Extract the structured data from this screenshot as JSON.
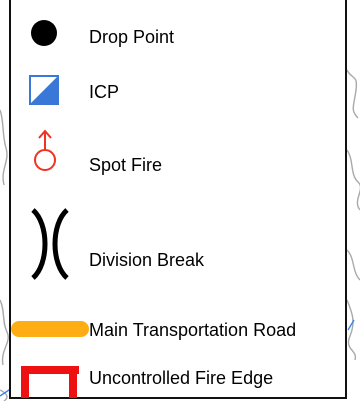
{
  "legend": {
    "items": [
      {
        "label": "Drop Point",
        "icon": "drop-point-icon"
      },
      {
        "label": "ICP",
        "icon": "icp-icon"
      },
      {
        "label": "Spot Fire",
        "icon": "spot-fire-icon"
      },
      {
        "label": "Division Break",
        "icon": "division-break-icon"
      },
      {
        "label": "Main Transportation Road",
        "icon": "main-road-icon"
      },
      {
        "label": "Uncontrolled Fire Edge",
        "icon": "fire-edge-icon"
      }
    ]
  },
  "colors": {
    "drop_point": "#000000",
    "icp_fill": "#3a78d8",
    "spot_fire": "#ee3322",
    "road": "#ffad14",
    "fire_edge": "#ee1111",
    "map_contours": "#a9a9a9",
    "map_water": "#3b82f6"
  }
}
